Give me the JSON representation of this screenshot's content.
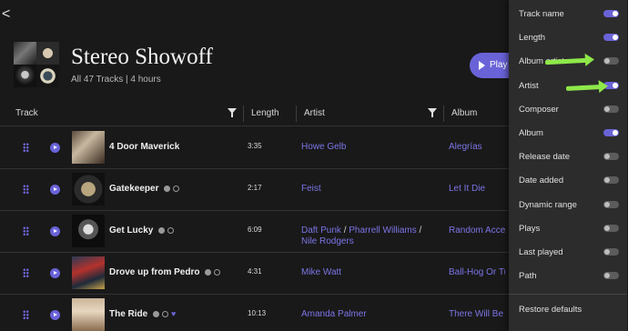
{
  "nav": {
    "back_glyph": "<"
  },
  "playlist": {
    "title": "Stereo Showoff",
    "subtitle": "All 47 Tracks | 4 hours",
    "play_label": "Play"
  },
  "columns": {
    "track": "Track",
    "length": "Length",
    "artist": "Artist",
    "album": "Album"
  },
  "tracks": [
    {
      "name": "4 Door Maverick",
      "length": "3:35",
      "artist_parts": [
        "Howe Gelb"
      ],
      "album": "Alegrías",
      "icons": []
    },
    {
      "name": "Gatekeeper",
      "length": "2:17",
      "artist_parts": [
        "Feist"
      ],
      "album": "Let It Die",
      "icons": [
        "sample-icon",
        "clock-icon"
      ]
    },
    {
      "name": "Get Lucky",
      "length": "6:09",
      "artist_parts": [
        "Daft Punk",
        "Pharrell Williams",
        "Nile Rodgers"
      ],
      "album": "Random Access",
      "icons": [
        "sample-icon",
        "clock-icon"
      ]
    },
    {
      "name": "Drove up from Pedro",
      "length": "4:31",
      "artist_parts": [
        "Mike Watt"
      ],
      "album": "Ball-Hog Or Tugb",
      "icons": [
        "edit-icon",
        "clock-icon"
      ]
    },
    {
      "name": "The Ride",
      "length": "10:13",
      "artist_parts": [
        "Amanda Palmer"
      ],
      "album": "There Will Be N",
      "icons": [
        "edit-icon",
        "clock-icon",
        "heart-icon"
      ]
    }
  ],
  "column_options": [
    {
      "label": "Track name",
      "on": true
    },
    {
      "label": "Length",
      "on": true
    },
    {
      "label": "Album artist",
      "on": false
    },
    {
      "label": "Artist",
      "on": true
    },
    {
      "label": "Composer",
      "on": false
    },
    {
      "label": "Album",
      "on": true
    },
    {
      "label": "Release date",
      "on": false
    },
    {
      "label": "Date added",
      "on": false
    },
    {
      "label": "Dynamic range",
      "on": false
    },
    {
      "label": "Plays",
      "on": false
    },
    {
      "label": "Last played",
      "on": false
    },
    {
      "label": "Path",
      "on": false
    }
  ],
  "panel": {
    "restore_label": "Restore defaults"
  },
  "colors": {
    "accent": "#6a63d8",
    "annotation_arrow": "#8ee84a"
  }
}
